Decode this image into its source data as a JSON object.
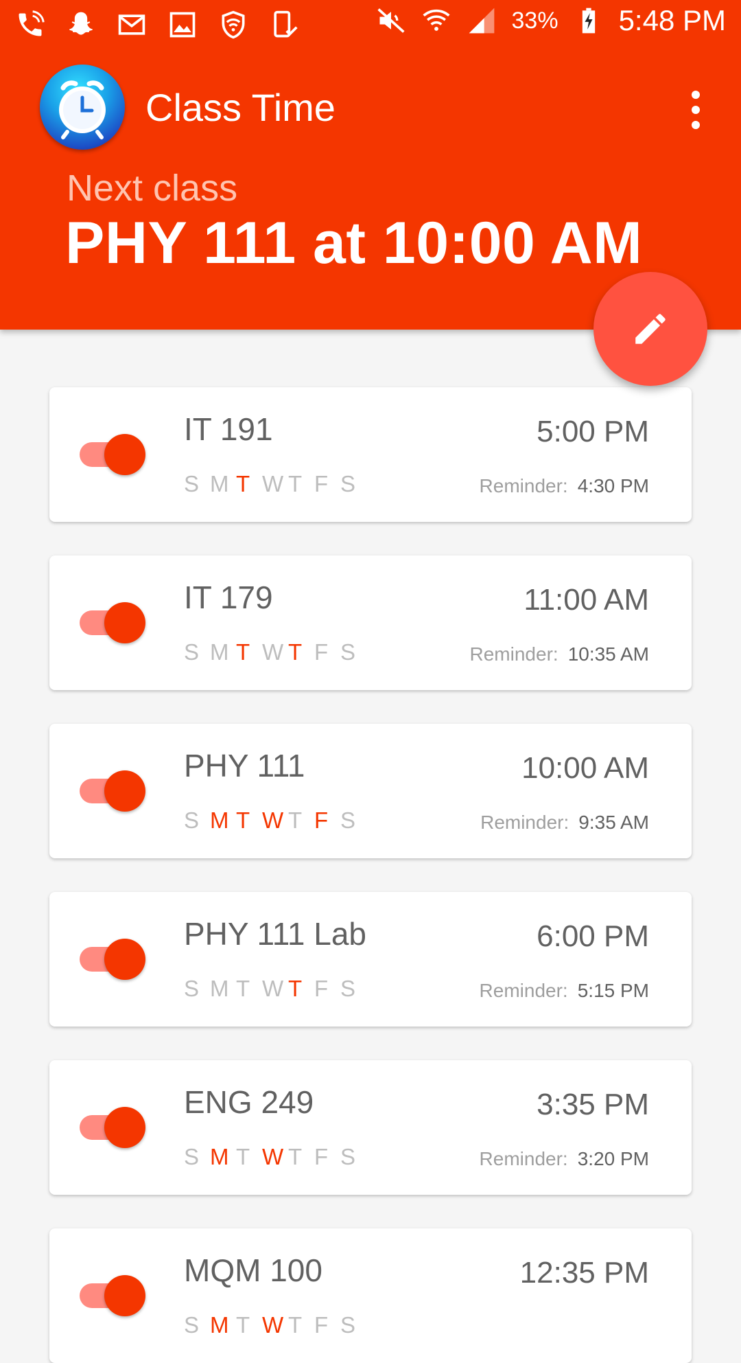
{
  "status_bar": {
    "battery": "33%",
    "time": "5:48 PM"
  },
  "app": {
    "title": "Class Time",
    "icon": "alarm-clock-icon"
  },
  "next": {
    "label": "Next class",
    "value": "PHY 111 at 10:00 AM"
  },
  "day_letters": [
    "S",
    "M",
    "T",
    "W",
    "T",
    "F",
    "S"
  ],
  "classes": [
    {
      "name": "IT 191",
      "time": "5:00 PM",
      "reminder_label": "Reminder:",
      "reminder": "4:30 PM",
      "enabled": true,
      "days": [
        false,
        false,
        true,
        false,
        false,
        false,
        false
      ]
    },
    {
      "name": "IT 179",
      "time": "11:00 AM",
      "reminder_label": "Reminder:",
      "reminder": "10:35 AM",
      "enabled": true,
      "days": [
        false,
        false,
        true,
        false,
        true,
        false,
        false
      ]
    },
    {
      "name": "PHY 111",
      "time": "10:00 AM",
      "reminder_label": "Reminder:",
      "reminder": "9:35 AM",
      "enabled": true,
      "days": [
        false,
        true,
        true,
        true,
        false,
        true,
        false
      ]
    },
    {
      "name": "PHY 111 Lab",
      "time": "6:00 PM",
      "reminder_label": "Reminder:",
      "reminder": "5:15 PM",
      "enabled": true,
      "days": [
        false,
        false,
        false,
        false,
        true,
        false,
        false
      ]
    },
    {
      "name": "ENG 249",
      "time": "3:35 PM",
      "reminder_label": "Reminder:",
      "reminder": "3:20 PM",
      "enabled": true,
      "days": [
        false,
        true,
        false,
        true,
        false,
        false,
        false
      ]
    },
    {
      "name": "MQM 100",
      "time": "12:35 PM",
      "reminder_label": "",
      "reminder": "",
      "enabled": true,
      "days": [
        false,
        true,
        false,
        true,
        false,
        false,
        false
      ]
    }
  ],
  "colors": {
    "primary": "#f43600",
    "fab": "#ff5240",
    "active_day": "#f43600",
    "inactive_day": "#bdbdbd"
  }
}
